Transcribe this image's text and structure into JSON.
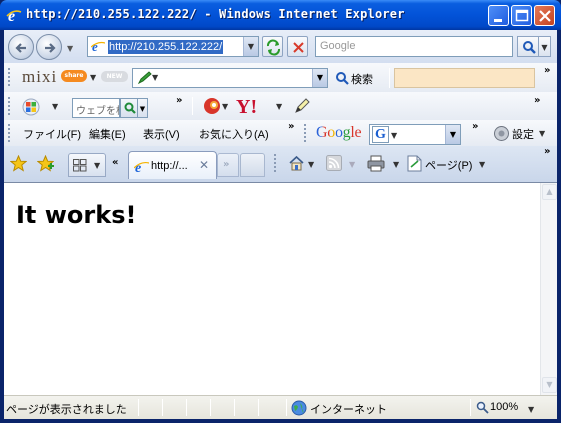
{
  "window": {
    "title": "http://210.255.122.222/ - Windows Internet Explorer",
    "caption_buttons": [
      "minimize",
      "maximize",
      "close"
    ]
  },
  "address_bar": {
    "url": "http://210.255.122.222/",
    "search_placeholder": "Google"
  },
  "mixi_toolbar": {
    "logo": "mixi",
    "badge": "share",
    "new_badge": "NEW",
    "search_label": "検索"
  },
  "second_toolbar": {
    "search_placeholder": "ウェブを検"
  },
  "menu_bar": {
    "items": [
      "ファイル(F)",
      "編集(E)",
      "表示(V)",
      "お気に入り(A)"
    ],
    "google_logo": "Google",
    "settings_label": "設定"
  },
  "tab_bar": {
    "tab_title": "http://...",
    "page_menu_label": "ページ(P)"
  },
  "page": {
    "heading": "It works!"
  },
  "status_bar": {
    "status_text": "ページが表示されました",
    "zone_text": "インターネット",
    "zoom": "100%"
  },
  "colors": {
    "titlebar": "#0353d8",
    "url_highlight": "#316ac5",
    "close_button": "#c4421f"
  }
}
